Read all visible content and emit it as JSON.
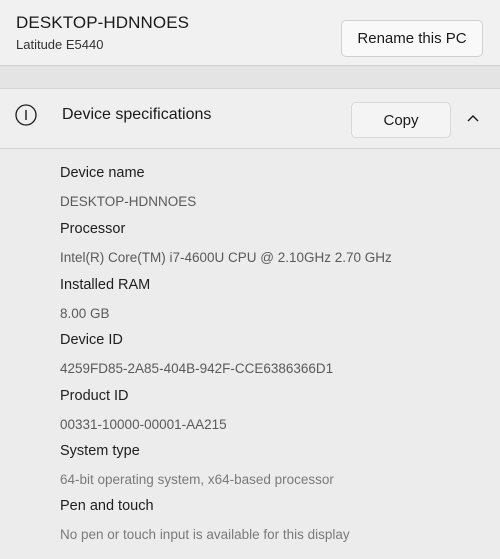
{
  "device": {
    "name": "DESKTOP-HDNNOES",
    "model": "Latitude E5440",
    "rename_label": "Rename this PC"
  },
  "specifications": {
    "title": "Device specifications",
    "copy_label": "Copy",
    "icon": "info-icon",
    "collapse_icon": "chevron-up-icon",
    "items": [
      {
        "label": "Device name",
        "value": "DESKTOP-HDNNOES"
      },
      {
        "label": "Processor",
        "value": "Intel(R) Core(TM) i7-4600U CPU @ 2.10GHz   2.70 GHz"
      },
      {
        "label": "Installed RAM",
        "value": "8.00 GB"
      },
      {
        "label": "Device ID",
        "value": "4259FD85-2A85-404B-942F-CCE6386366D1"
      },
      {
        "label": "Product ID",
        "value": "00331-10000-00001-AA215"
      },
      {
        "label": "System type",
        "value": "64-bit operating system, x64-based processor"
      },
      {
        "label": "Pen and touch",
        "value": "No pen or touch input is available for this display"
      }
    ]
  }
}
